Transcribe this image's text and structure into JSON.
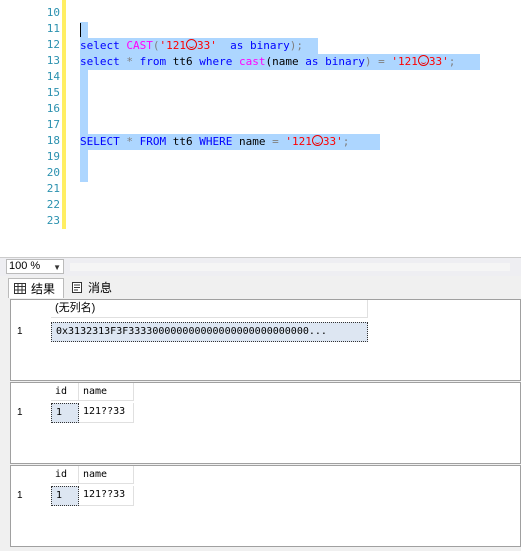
{
  "editor": {
    "line_numbers": [
      "10",
      "11",
      "12",
      "13",
      "14",
      "15",
      "16",
      "17",
      "18",
      "19",
      "20",
      "21",
      "22",
      "23"
    ],
    "line12": {
      "kw1": "select",
      "fn": "CAST",
      "open": "(",
      "str1": "'121",
      "str2": "33'",
      "kw2": "as",
      "kw3": "binary",
      "close": ");"
    },
    "line13": {
      "kw1": "select",
      "star": "*",
      "kw2": "from",
      "tbl": "tt6",
      "kw3": "where",
      "fn": "cast",
      "arg": "(name",
      "kw4": "as",
      "kw5": "binary",
      "close": ")",
      "eq": "=",
      "str1": "'121",
      "str2": "33'",
      "semi": ";"
    },
    "line18": {
      "kw1": "SELECT",
      "star": "*",
      "kw2": "FROM",
      "tbl": "tt6",
      "kw3": "WHERE",
      "col": "name",
      "eq": "=",
      "str1": "'121",
      "str2": "33'",
      "semi": ";"
    }
  },
  "zoom": {
    "value": "100 %"
  },
  "tabs": [
    {
      "label": "结果",
      "icon": "grid-icon",
      "active": true
    },
    {
      "label": "消息",
      "icon": "message-icon",
      "active": false
    }
  ],
  "grids": [
    {
      "columns": [
        "(无列名)"
      ],
      "rows": [
        {
          "num": "1",
          "cells": [
            "0x3132313F3F333300000000000000000000000000..."
          ]
        }
      ]
    },
    {
      "columns": [
        "id",
        "name"
      ],
      "rows": [
        {
          "num": "1",
          "cells": [
            "1",
            "121??33"
          ]
        }
      ]
    },
    {
      "columns": [
        "id",
        "name"
      ],
      "rows": [
        {
          "num": "1",
          "cells": [
            "1",
            "121??33"
          ]
        }
      ]
    }
  ],
  "colors": {
    "selection": "#add6ff",
    "keyword": "#0000ff",
    "function": "#ff00ff",
    "string": "#ff0000",
    "line_number": "#2b91af"
  }
}
